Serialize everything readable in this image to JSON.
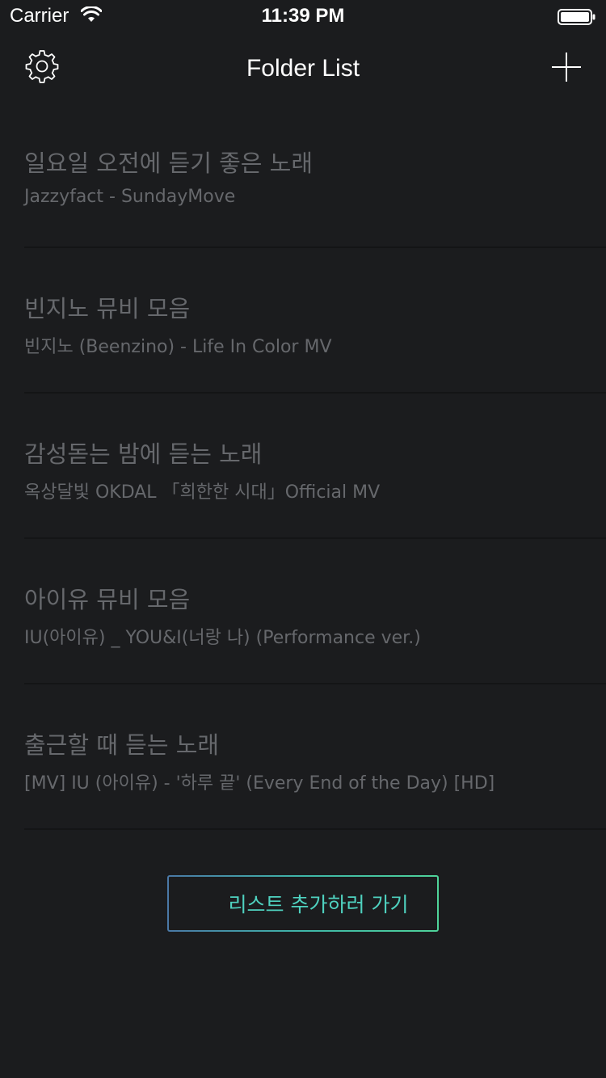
{
  "status_bar": {
    "carrier": "Carrier",
    "time": "11:39 PM",
    "wifi_icon": "wifi-icon",
    "battery_icon": "battery-icon"
  },
  "nav": {
    "title": "Folder List",
    "left_icon": "gear-icon",
    "right_icon": "plus-icon"
  },
  "folders": [
    {
      "title": "일요일 오전에 듣기 좋은 노래",
      "subtitle": "Jazzyfact - SundayMove"
    },
    {
      "title": "빈지노 뮤비 모음",
      "subtitle": "빈지노 (Beenzino) - Life In Color MV"
    },
    {
      "title": "감성돋는 밤에 듣는 노래",
      "subtitle": "옥상달빛 OKDAL 「희한한 시대」Official MV"
    },
    {
      "title": "아이유 뮤비 모음",
      "subtitle": "IU(아이유) _ YOU&I(너랑 나) (Performance ver.)"
    },
    {
      "title": "출근할 때 듣는 노래",
      "subtitle": "[MV] IU (아이유) - '하루 끝' (Every End of the Day) [HD]"
    }
  ],
  "add_list_button": {
    "label": "리스트 추가하러 가기",
    "icon": "plus-icon"
  },
  "colors": {
    "background": "#1b1c1e",
    "text_primary": "#ffffff",
    "text_muted": "#66686c",
    "accent_start": "#4a78a6",
    "accent_end": "#4fd39a",
    "accent_text": "#4fd2c0"
  }
}
